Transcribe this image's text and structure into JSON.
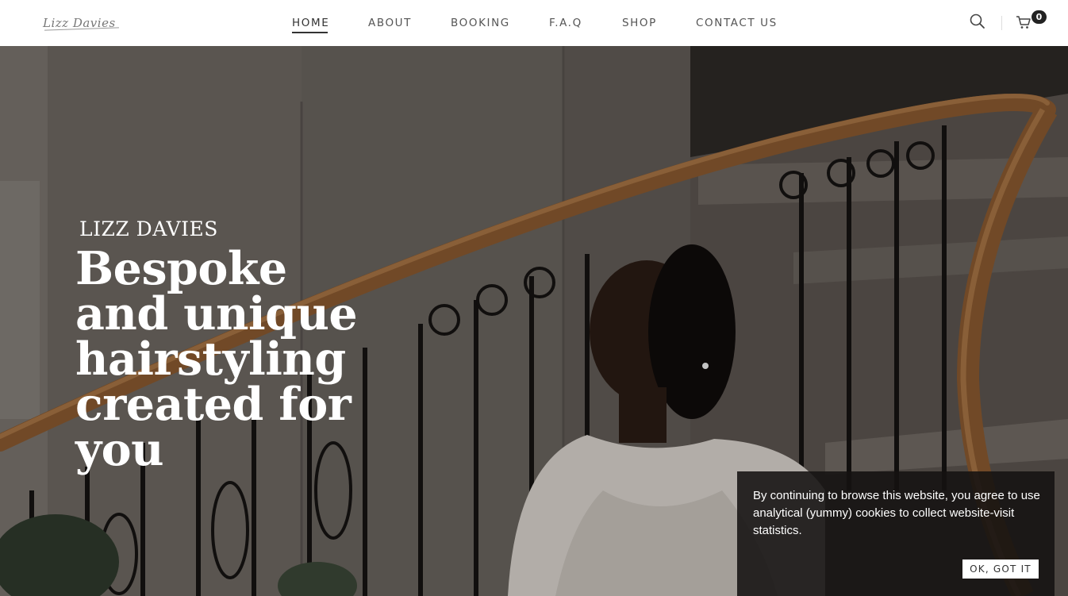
{
  "header": {
    "logo_text": "Lizz Davies",
    "nav": [
      {
        "label": "HOME",
        "active": true
      },
      {
        "label": "ABOUT",
        "active": false
      },
      {
        "label": "BOOKING",
        "active": false
      },
      {
        "label": "F.A.Q",
        "active": false
      },
      {
        "label": "SHOP",
        "active": false
      },
      {
        "label": "CONTACT US",
        "active": false
      }
    ],
    "search_icon": "search-icon",
    "cart_icon": "cart-icon",
    "cart_count": "0"
  },
  "hero": {
    "kicker": "LIZZ DAVIES",
    "title": "Bespoke and unique hairstyling created for you",
    "image": "bride-on-staircase-photo"
  },
  "cookie_banner": {
    "text": "By continuing to browse this website, you agree to use analytical (yummy) cookies to collect website-visit statistics.",
    "button_label": "OK, GOT IT"
  },
  "colors": {
    "header_bg": "#ffffff",
    "nav_text": "#555555",
    "hero_text": "#ffffff",
    "banner_bg": "#141211",
    "button_bg": "#ffffff"
  }
}
